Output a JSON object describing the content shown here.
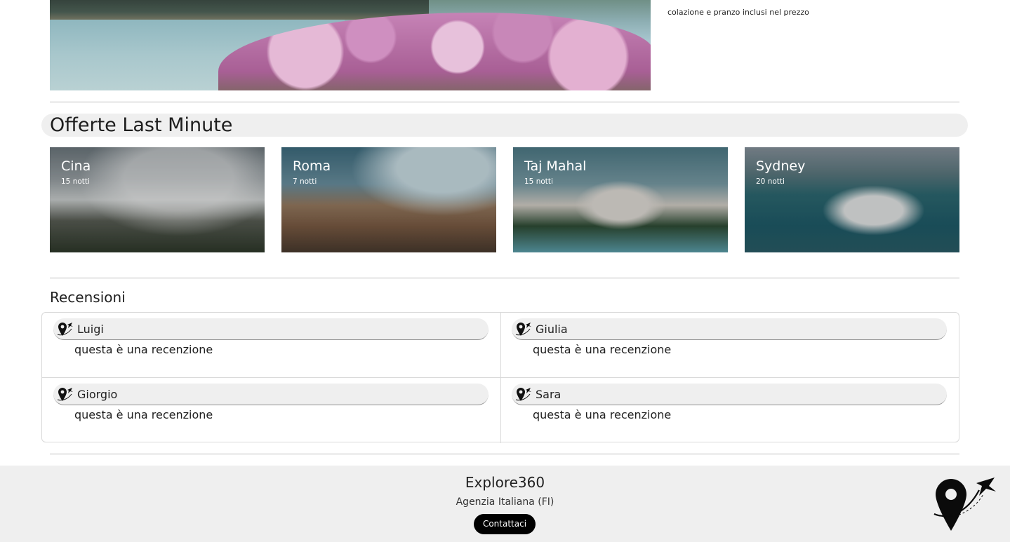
{
  "hero": {
    "caption": "colazione e pranzo inclusi nel prezzo"
  },
  "offers": {
    "title": "Offerte Last Minute",
    "items": [
      {
        "name": "Cina",
        "nights": "15 notti"
      },
      {
        "name": "Roma",
        "nights": "7 notti"
      },
      {
        "name": "Taj Mahal",
        "nights": "15 notti"
      },
      {
        "name": "Sydney",
        "nights": "20 notti"
      }
    ]
  },
  "reviews": {
    "title": "Recensioni",
    "items": [
      {
        "user": "Luigi",
        "text": "questa è una recenzione"
      },
      {
        "user": "Giulia",
        "text": "questa è una recenzione"
      },
      {
        "user": "Giorgio",
        "text": "questa è una recenzione"
      },
      {
        "user": "Sara",
        "text": "questa è una recenzione"
      }
    ]
  },
  "footer": {
    "brand": "Explore360",
    "subtitle": "Agenzia Italiana (FI)",
    "contact_label": "Contattaci",
    "logo_icon": "location-pin-plane-icon"
  }
}
